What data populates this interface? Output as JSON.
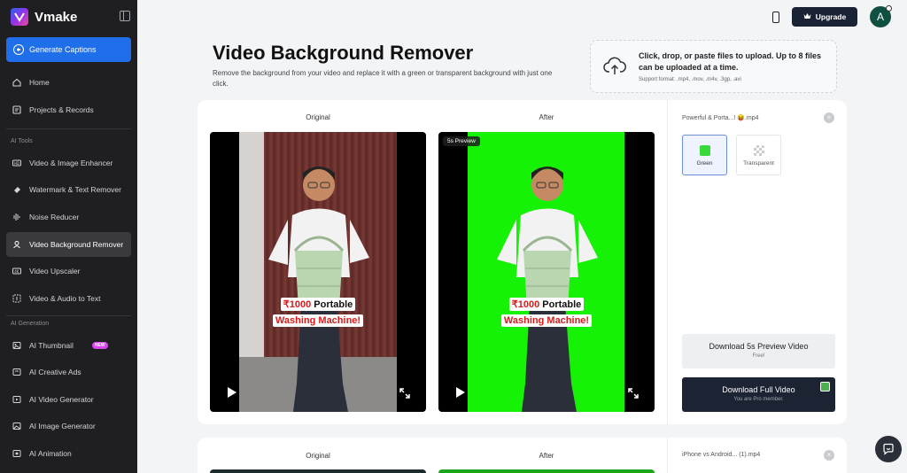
{
  "sidebar": {
    "brand": "Vmake",
    "generate_label": "Generate Captions",
    "items_top": [
      {
        "label": "Home",
        "icon": "home-icon"
      },
      {
        "label": "Projects & Records",
        "icon": "records-icon"
      }
    ],
    "section_ai_tools": "AI Tools",
    "ai_tools": [
      {
        "label": "Video & Image Enhancer",
        "icon": "hd-icon"
      },
      {
        "label": "Watermark & Text Remover",
        "icon": "eraser-icon"
      },
      {
        "label": "Noise Reducer",
        "icon": "sparkle-icon"
      },
      {
        "label": "Video Background Remover",
        "icon": "person-cutout-icon",
        "active": true
      },
      {
        "label": "Video Upscaler",
        "icon": "upscale-icon"
      },
      {
        "label": "Video & Audio to Text",
        "icon": "transcribe-icon"
      }
    ],
    "section_ai_generation": "AI Generation",
    "ai_generation": [
      {
        "label": "AI Thumbnail",
        "icon": "thumbnail-icon",
        "badge": "NEW"
      },
      {
        "label": "AI Creative Ads",
        "icon": "ads-icon"
      },
      {
        "label": "AI Video Generator",
        "icon": "video-gen-icon"
      },
      {
        "label": "AI Image Generator",
        "icon": "image-gen-icon"
      },
      {
        "label": "AI Animation",
        "icon": "animation-icon"
      }
    ]
  },
  "topbar": {
    "upgrade_label": "Upgrade",
    "avatar_initial": "A"
  },
  "main": {
    "title": "Video Background Remover",
    "description": "Remove the background from your video and replace it with a green or transparent background with just one click.",
    "upload": {
      "main_text": "Click, drop, or paste files to upload. Up to 8 files can be uploaded at a time.",
      "support_text": "Support format: .mp4, .mov, .m4v, .3gp, .avi"
    }
  },
  "card1": {
    "original_label": "Original",
    "after_label": "After",
    "preview_badge": "5s Preview",
    "caption_line1_price": "₹1000",
    "caption_line1_text": " Portable",
    "caption_line2": "Washing Machine!",
    "file_name": "Powerful & Porta...! 😝.mp4",
    "bg_options": [
      {
        "label": "Green",
        "selected": true
      },
      {
        "label": "Transparent",
        "selected": false
      }
    ],
    "download_preview": {
      "title": "Download 5s Preview Video",
      "sub": "Free!"
    },
    "download_full": {
      "title": "Download Full Video",
      "sub": "You are Pro member."
    },
    "accent_colors": {
      "green_screen": "#16f205",
      "primary_blue": "#1f6feb",
      "dark_button": "#1c2433"
    }
  },
  "card2": {
    "original_label": "Original",
    "after_label": "After",
    "file_name": "iPhone vs Android... (1).mp4"
  }
}
